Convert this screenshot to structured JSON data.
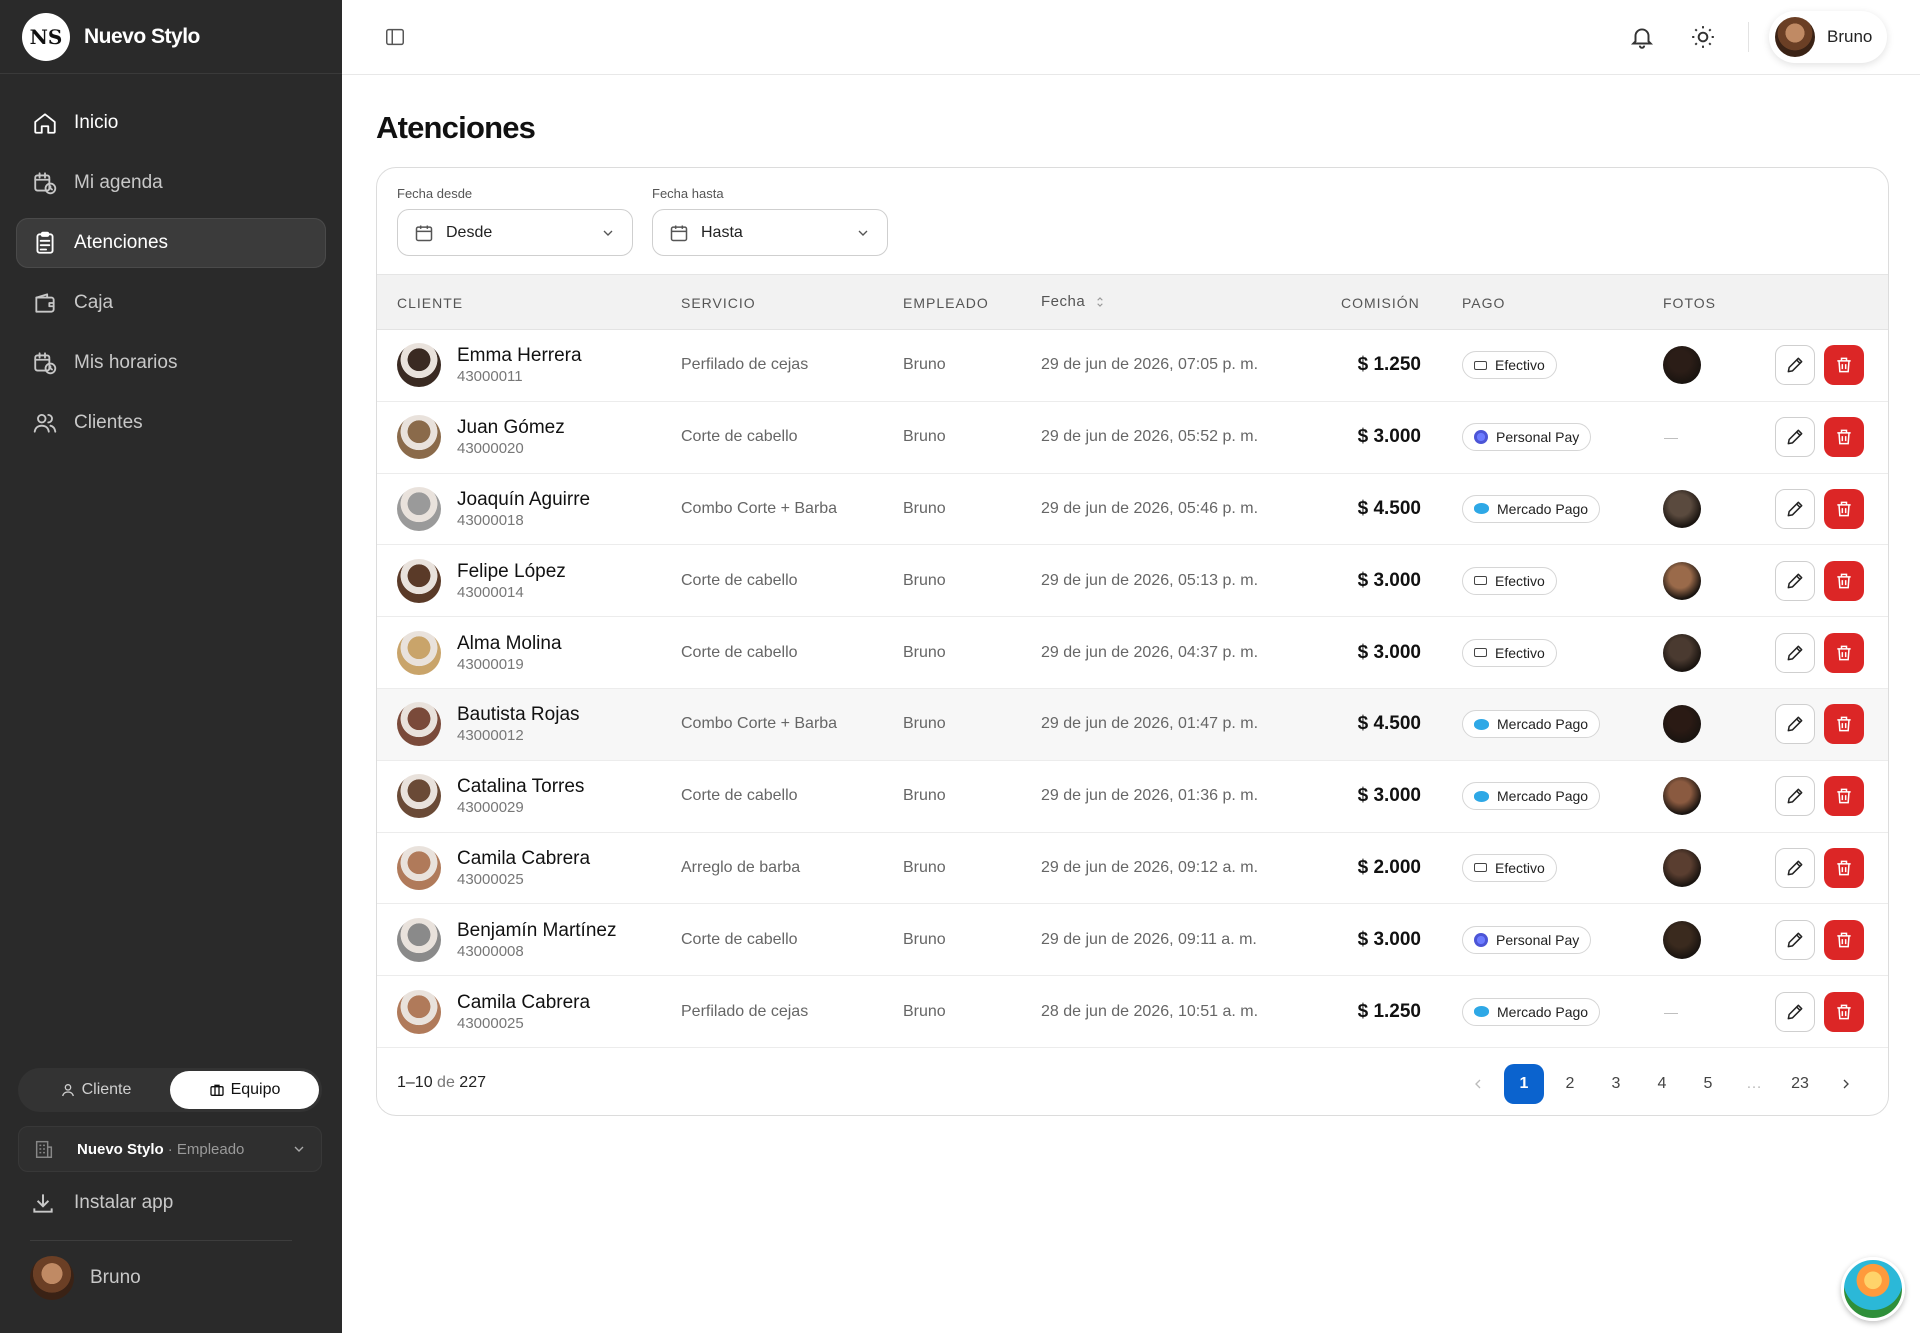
{
  "brand": {
    "logo_text": "NS",
    "name": "Nuevo Stylo"
  },
  "sidebar": {
    "items": [
      {
        "label": "Inicio",
        "icon": "home-icon",
        "active": false
      },
      {
        "label": "Mi agenda",
        "icon": "calendar-clock-icon",
        "active": false
      },
      {
        "label": "Atenciones",
        "icon": "clipboard-icon",
        "active": true
      },
      {
        "label": "Caja",
        "icon": "wallet-icon",
        "active": false
      },
      {
        "label": "Mis horarios",
        "icon": "calendar-clock-icon",
        "active": false
      },
      {
        "label": "Clientes",
        "icon": "users-icon",
        "active": false
      }
    ],
    "toggle": {
      "cliente": "Cliente",
      "equipo": "Equipo",
      "active": "equipo"
    },
    "org": {
      "name": "Nuevo Stylo",
      "role": "· Empleado"
    },
    "install_label": "Instalar app",
    "user_name": "Bruno"
  },
  "topbar": {
    "user_name": "Bruno"
  },
  "page": {
    "title": "Atenciones"
  },
  "filters": {
    "from_label": "Fecha desde",
    "from_value": "Desde",
    "to_label": "Fecha hasta",
    "to_value": "Hasta"
  },
  "table": {
    "headers": {
      "cliente": "CLIENTE",
      "servicio": "SERVICIO",
      "empleado": "EMPLEADO",
      "fecha": "Fecha",
      "comision": "COMISIÓN",
      "pago": "PAGO",
      "fotos": "FOTOS"
    },
    "rows": [
      {
        "name": "Emma Herrera",
        "id": "43000011",
        "service": "Perfilado de cejas",
        "employee": "Bruno",
        "date": "29 de jun de 2026, 07:05 p. m.",
        "commission": "$ 1.250",
        "payment": "Efectivo",
        "pay_type": "cash",
        "photo": true,
        "avatar_color": "#3a2a22",
        "photo_color": "#2b1d17"
      },
      {
        "name": "Juan Gómez",
        "id": "43000020",
        "service": "Corte de cabello",
        "employee": "Bruno",
        "date": "29 de jun de 2026, 05:52 p. m.",
        "commission": "$ 3.000",
        "payment": "Personal Pay",
        "pay_type": "personal",
        "photo": false,
        "avatar_color": "#8a6a4a",
        "photo_color": ""
      },
      {
        "name": "Joaquín Aguirre",
        "id": "43000018",
        "service": "Combo Corte + Barba",
        "employee": "Bruno",
        "date": "29 de jun de 2026, 05:46 p. m.",
        "commission": "$ 4.500",
        "payment": "Mercado Pago",
        "pay_type": "mp",
        "photo": true,
        "avatar_color": "#9a9a9a",
        "photo_color": "#5a4a3e"
      },
      {
        "name": "Felipe López",
        "id": "43000014",
        "service": "Corte de cabello",
        "employee": "Bruno",
        "date": "29 de jun de 2026, 05:13 p. m.",
        "commission": "$ 3.000",
        "payment": "Efectivo",
        "pay_type": "cash",
        "photo": true,
        "avatar_color": "#5a3a28",
        "photo_color": "#9a6a4a"
      },
      {
        "name": "Alma Molina",
        "id": "43000019",
        "service": "Corte de cabello",
        "employee": "Bruno",
        "date": "29 de jun de 2026, 04:37 p. m.",
        "commission": "$ 3.000",
        "payment": "Efectivo",
        "pay_type": "cash",
        "photo": true,
        "avatar_color": "#c9a46a",
        "photo_color": "#4a3a30"
      },
      {
        "name": "Bautista Rojas",
        "id": "43000012",
        "service": "Combo Corte + Barba",
        "employee": "Bruno",
        "date": "29 de jun de 2026, 01:47 p. m.",
        "commission": "$ 4.500",
        "payment": "Mercado Pago",
        "pay_type": "mp",
        "photo": true,
        "avatar_color": "#7a4a3a",
        "photo_color": "#2a1a14"
      },
      {
        "name": "Catalina Torres",
        "id": "43000029",
        "service": "Corte de cabello",
        "employee": "Bruno",
        "date": "29 de jun de 2026, 01:36 p. m.",
        "commission": "$ 3.000",
        "payment": "Mercado Pago",
        "pay_type": "mp",
        "photo": true,
        "avatar_color": "#6a4a36",
        "photo_color": "#8a5a40"
      },
      {
        "name": "Camila Cabrera",
        "id": "43000025",
        "service": "Arreglo de barba",
        "employee": "Bruno",
        "date": "29 de jun de 2026, 09:12 a. m.",
        "commission": "$ 2.000",
        "payment": "Efectivo",
        "pay_type": "cash",
        "photo": true,
        "avatar_color": "#b07a5a",
        "photo_color": "#5a3e30"
      },
      {
        "name": "Benjamín Martínez",
        "id": "43000008",
        "service": "Corte de cabello",
        "employee": "Bruno",
        "date": "29 de jun de 2026, 09:11 a. m.",
        "commission": "$ 3.000",
        "payment": "Personal Pay",
        "pay_type": "personal",
        "photo": true,
        "avatar_color": "#8a8a8a",
        "photo_color": "#3a2a1e"
      },
      {
        "name": "Camila Cabrera",
        "id": "43000025",
        "service": "Perfilado de cejas",
        "employee": "Bruno",
        "date": "28 de jun de 2026, 10:51 a. m.",
        "commission": "$ 1.250",
        "payment": "Mercado Pago",
        "pay_type": "mp",
        "photo": false,
        "avatar_color": "#b07a5a",
        "photo_color": ""
      }
    ],
    "highlighted_row": 5,
    "no_photo_text": "—"
  },
  "footer": {
    "range": "1–10",
    "de": "de",
    "total": "227",
    "pages": [
      "1",
      "2",
      "3",
      "4",
      "5",
      "…",
      "23"
    ],
    "current_page": "1"
  }
}
